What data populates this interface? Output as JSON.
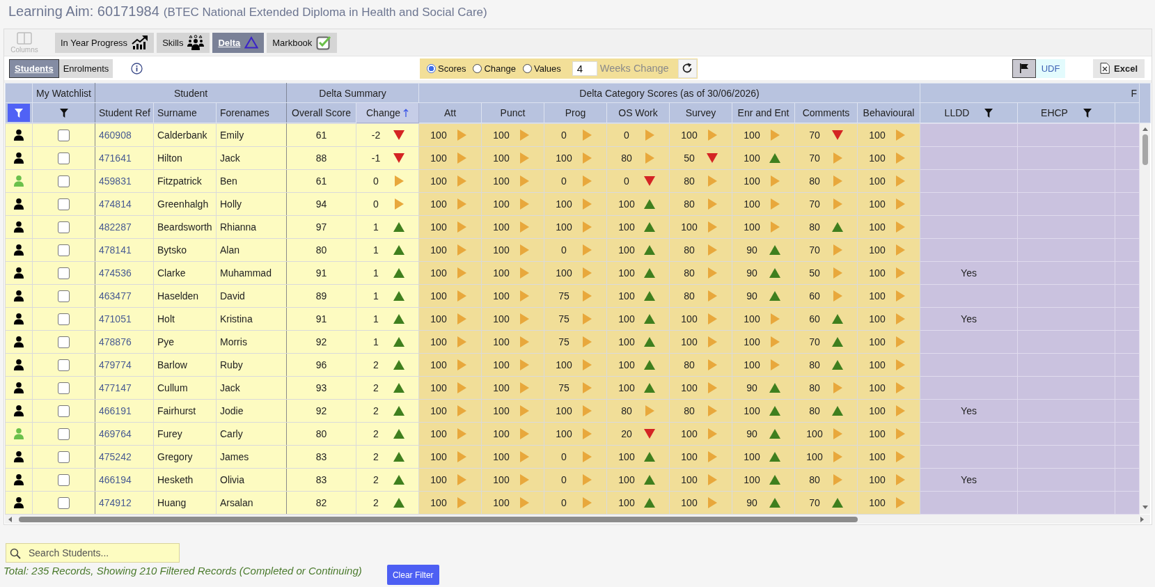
{
  "title": {
    "aim": "Learning Aim: 60171984",
    "qualification": "(BTEC National Extended Diploma in Health and Social Care)"
  },
  "toolbar": {
    "columns_button": {
      "label": "Columns",
      "disabled": true
    },
    "views": [
      {
        "label": "In Year Progress",
        "selected": false
      },
      {
        "label": "Skills",
        "selected": false
      },
      {
        "label": "Delta",
        "selected": true
      },
      {
        "label": "Markbook",
        "selected": false
      }
    ]
  },
  "grid_bar": {
    "modes": [
      {
        "label": "Students",
        "selected": true
      },
      {
        "label": "Enrolments",
        "selected": false
      }
    ],
    "display_options": [
      {
        "label": "Scores",
        "selected": true
      },
      {
        "label": "Change",
        "selected": false
      },
      {
        "label": "Values",
        "selected": false
      }
    ],
    "weeks_change": {
      "value": "4",
      "label": "Weeks Change"
    },
    "flag_toggle": {
      "on": true
    },
    "udf_button": {
      "label": "UDF"
    },
    "excel_button": {
      "label": "Excel"
    }
  },
  "table": {
    "groups": [
      {
        "label": "My Watchlist",
        "columns": [
          {
            "kind": "filter"
          }
        ]
      },
      {
        "label": "Student",
        "columns": [
          {
            "kind": "plain",
            "label": "Student Ref"
          },
          {
            "kind": "plain",
            "label": "Surname"
          },
          {
            "kind": "plain",
            "label": "Forenames"
          }
        ]
      },
      {
        "label": "Delta Summary",
        "columns": [
          {
            "kind": "plain",
            "label": "Overall Score"
          },
          {
            "kind": "sorted",
            "label": "Change"
          }
        ]
      },
      {
        "label": "Delta Category Scores (as of 30/06/2026)",
        "columns": [
          {
            "kind": "plain",
            "label": "Att"
          },
          {
            "kind": "plain",
            "label": "Punct"
          },
          {
            "kind": "plain",
            "label": "Prog"
          },
          {
            "kind": "plain",
            "label": "OS Work"
          },
          {
            "kind": "plain",
            "label": "Survey"
          },
          {
            "kind": "plain",
            "label": "Enr and Ent"
          },
          {
            "kind": "plain",
            "label": "Comments"
          },
          {
            "kind": "plain",
            "label": "Behavioural"
          }
        ]
      },
      {
        "label": "F",
        "columns": [
          {
            "kind": "filter",
            "label": "LLDD"
          },
          {
            "kind": "filter",
            "label": "EHCP"
          },
          {
            "kind": "blank"
          }
        ]
      }
    ],
    "rows": [
      {
        "color": "#000000",
        "watchlist": false,
        "ref": "460908",
        "surname": "Calderbank",
        "forenames": "Emily",
        "overall": "61",
        "change": {
          "value": "-2",
          "kind": "down"
        },
        "scores": [
          {
            "value": "100",
            "kind": "flat"
          },
          {
            "value": "100",
            "kind": "flat"
          },
          {
            "value": "0",
            "kind": "flat"
          },
          {
            "value": "0",
            "kind": "flat"
          },
          {
            "value": "100",
            "kind": "flat"
          },
          {
            "value": "100",
            "kind": "flat"
          },
          {
            "value": "70",
            "kind": "down"
          },
          {
            "value": "100",
            "kind": "flat"
          }
        ]
      },
      {
        "color": "#000000",
        "watchlist": false,
        "ref": "471641",
        "surname": "Hilton",
        "forenames": "Jack",
        "overall": "88",
        "change": {
          "value": "-1",
          "kind": "down"
        },
        "scores": [
          {
            "value": "100",
            "kind": "flat"
          },
          {
            "value": "100",
            "kind": "flat"
          },
          {
            "value": "100",
            "kind": "flat"
          },
          {
            "value": "80",
            "kind": "flat"
          },
          {
            "value": "50",
            "kind": "down"
          },
          {
            "value": "100",
            "kind": "up"
          },
          {
            "value": "70",
            "kind": "flat"
          },
          {
            "value": "100",
            "kind": "flat"
          }
        ]
      },
      {
        "color": "#6bc04b",
        "watchlist": false,
        "ref": "459831",
        "surname": "Fitzpatrick",
        "forenames": "Ben",
        "overall": "61",
        "change": {
          "value": "0",
          "kind": "flat"
        },
        "scores": [
          {
            "value": "100",
            "kind": "flat"
          },
          {
            "value": "100",
            "kind": "flat"
          },
          {
            "value": "0",
            "kind": "flat"
          },
          {
            "value": "0",
            "kind": "down"
          },
          {
            "value": "80",
            "kind": "flat"
          },
          {
            "value": "100",
            "kind": "flat"
          },
          {
            "value": "80",
            "kind": "flat"
          },
          {
            "value": "100",
            "kind": "flat"
          }
        ]
      },
      {
        "color": "#000000",
        "watchlist": false,
        "ref": "474814",
        "surname": "Greenhalgh",
        "forenames": "Holly",
        "overall": "94",
        "change": {
          "value": "0",
          "kind": "flat"
        },
        "scores": [
          {
            "value": "100",
            "kind": "flat"
          },
          {
            "value": "100",
            "kind": "flat"
          },
          {
            "value": "100",
            "kind": "flat"
          },
          {
            "value": "100",
            "kind": "up"
          },
          {
            "value": "80",
            "kind": "flat"
          },
          {
            "value": "100",
            "kind": "flat"
          },
          {
            "value": "70",
            "kind": "flat"
          },
          {
            "value": "100",
            "kind": "flat"
          }
        ]
      },
      {
        "color": "#000000",
        "watchlist": false,
        "ref": "482287",
        "surname": "Beardsworth",
        "forenames": "Rhianna",
        "overall": "97",
        "change": {
          "value": "1",
          "kind": "up"
        },
        "scores": [
          {
            "value": "100",
            "kind": "flat"
          },
          {
            "value": "100",
            "kind": "flat"
          },
          {
            "value": "100",
            "kind": "flat"
          },
          {
            "value": "100",
            "kind": "up"
          },
          {
            "value": "100",
            "kind": "flat"
          },
          {
            "value": "100",
            "kind": "flat"
          },
          {
            "value": "80",
            "kind": "up"
          },
          {
            "value": "100",
            "kind": "flat"
          }
        ]
      },
      {
        "color": "#000000",
        "watchlist": false,
        "ref": "478141",
        "surname": "Bytsko",
        "forenames": "Alan",
        "overall": "80",
        "change": {
          "value": "1",
          "kind": "up"
        },
        "scores": [
          {
            "value": "100",
            "kind": "flat"
          },
          {
            "value": "100",
            "kind": "flat"
          },
          {
            "value": "0",
            "kind": "flat"
          },
          {
            "value": "100",
            "kind": "up"
          },
          {
            "value": "80",
            "kind": "flat"
          },
          {
            "value": "90",
            "kind": "up"
          },
          {
            "value": "70",
            "kind": "flat"
          },
          {
            "value": "100",
            "kind": "flat"
          }
        ]
      },
      {
        "color": "#000000",
        "watchlist": false,
        "ref": "474536",
        "surname": "Clarke",
        "forenames": "Muhammad",
        "overall": "91",
        "change": {
          "value": "1",
          "kind": "up"
        },
        "scores": [
          {
            "value": "100",
            "kind": "flat"
          },
          {
            "value": "100",
            "kind": "flat"
          },
          {
            "value": "100",
            "kind": "flat"
          },
          {
            "value": "100",
            "kind": "up"
          },
          {
            "value": "80",
            "kind": "flat"
          },
          {
            "value": "90",
            "kind": "up"
          },
          {
            "value": "50",
            "kind": "flat"
          },
          {
            "value": "100",
            "kind": "flat"
          }
        ],
        "lldd": "Yes"
      },
      {
        "color": "#000000",
        "watchlist": false,
        "ref": "463477",
        "surname": "Haselden",
        "forenames": "David",
        "overall": "89",
        "change": {
          "value": "1",
          "kind": "up"
        },
        "scores": [
          {
            "value": "100",
            "kind": "flat"
          },
          {
            "value": "100",
            "kind": "flat"
          },
          {
            "value": "75",
            "kind": "flat"
          },
          {
            "value": "100",
            "kind": "up"
          },
          {
            "value": "80",
            "kind": "flat"
          },
          {
            "value": "90",
            "kind": "up"
          },
          {
            "value": "60",
            "kind": "flat"
          },
          {
            "value": "100",
            "kind": "flat"
          }
        ]
      },
      {
        "color": "#000000",
        "watchlist": false,
        "ref": "471051",
        "surname": "Holt",
        "forenames": "Kristina",
        "overall": "91",
        "change": {
          "value": "1",
          "kind": "up"
        },
        "scores": [
          {
            "value": "100",
            "kind": "flat"
          },
          {
            "value": "100",
            "kind": "flat"
          },
          {
            "value": "75",
            "kind": "flat"
          },
          {
            "value": "100",
            "kind": "up"
          },
          {
            "value": "100",
            "kind": "flat"
          },
          {
            "value": "100",
            "kind": "flat"
          },
          {
            "value": "60",
            "kind": "up"
          },
          {
            "value": "100",
            "kind": "flat"
          }
        ],
        "lldd": "Yes"
      },
      {
        "color": "#000000",
        "watchlist": false,
        "ref": "478876",
        "surname": "Pye",
        "forenames": "Morris",
        "overall": "92",
        "change": {
          "value": "1",
          "kind": "up"
        },
        "scores": [
          {
            "value": "100",
            "kind": "flat"
          },
          {
            "value": "100",
            "kind": "flat"
          },
          {
            "value": "75",
            "kind": "flat"
          },
          {
            "value": "100",
            "kind": "up"
          },
          {
            "value": "100",
            "kind": "flat"
          },
          {
            "value": "100",
            "kind": "flat"
          },
          {
            "value": "70",
            "kind": "up"
          },
          {
            "value": "100",
            "kind": "flat"
          }
        ]
      },
      {
        "color": "#000000",
        "watchlist": false,
        "ref": "479774",
        "surname": "Barlow",
        "forenames": "Ruby",
        "overall": "96",
        "change": {
          "value": "2",
          "kind": "up"
        },
        "scores": [
          {
            "value": "100",
            "kind": "flat"
          },
          {
            "value": "100",
            "kind": "flat"
          },
          {
            "value": "100",
            "kind": "flat"
          },
          {
            "value": "100",
            "kind": "up"
          },
          {
            "value": "80",
            "kind": "flat"
          },
          {
            "value": "100",
            "kind": "flat"
          },
          {
            "value": "80",
            "kind": "up"
          },
          {
            "value": "100",
            "kind": "flat"
          }
        ]
      },
      {
        "color": "#000000",
        "watchlist": false,
        "ref": "477147",
        "surname": "Cullum",
        "forenames": "Jack",
        "overall": "93",
        "change": {
          "value": "2",
          "kind": "up"
        },
        "scores": [
          {
            "value": "100",
            "kind": "flat"
          },
          {
            "value": "100",
            "kind": "flat"
          },
          {
            "value": "75",
            "kind": "flat"
          },
          {
            "value": "100",
            "kind": "up"
          },
          {
            "value": "100",
            "kind": "flat"
          },
          {
            "value": "90",
            "kind": "up"
          },
          {
            "value": "80",
            "kind": "flat"
          },
          {
            "value": "100",
            "kind": "flat"
          }
        ]
      },
      {
        "color": "#000000",
        "watchlist": false,
        "ref": "466191",
        "surname": "Fairhurst",
        "forenames": "Jodie",
        "overall": "92",
        "change": {
          "value": "2",
          "kind": "up"
        },
        "scores": [
          {
            "value": "100",
            "kind": "flat"
          },
          {
            "value": "100",
            "kind": "flat"
          },
          {
            "value": "100",
            "kind": "flat"
          },
          {
            "value": "80",
            "kind": "flat"
          },
          {
            "value": "80",
            "kind": "flat"
          },
          {
            "value": "100",
            "kind": "up"
          },
          {
            "value": "80",
            "kind": "up"
          },
          {
            "value": "100",
            "kind": "flat"
          }
        ],
        "lldd": "Yes"
      },
      {
        "color": "#6bc04b",
        "watchlist": false,
        "ref": "469764",
        "surname": "Furey",
        "forenames": "Carly",
        "overall": "80",
        "change": {
          "value": "2",
          "kind": "up"
        },
        "scores": [
          {
            "value": "100",
            "kind": "flat"
          },
          {
            "value": "100",
            "kind": "flat"
          },
          {
            "value": "100",
            "kind": "flat"
          },
          {
            "value": "20",
            "kind": "down"
          },
          {
            "value": "100",
            "kind": "flat"
          },
          {
            "value": "90",
            "kind": "up"
          },
          {
            "value": "100",
            "kind": "flat"
          },
          {
            "value": "100",
            "kind": "flat"
          }
        ]
      },
      {
        "color": "#000000",
        "watchlist": false,
        "ref": "475242",
        "surname": "Gregory",
        "forenames": "James",
        "overall": "83",
        "change": {
          "value": "2",
          "kind": "up"
        },
        "scores": [
          {
            "value": "100",
            "kind": "flat"
          },
          {
            "value": "100",
            "kind": "flat"
          },
          {
            "value": "0",
            "kind": "flat"
          },
          {
            "value": "100",
            "kind": "up"
          },
          {
            "value": "100",
            "kind": "flat"
          },
          {
            "value": "100",
            "kind": "up"
          },
          {
            "value": "100",
            "kind": "flat"
          },
          {
            "value": "100",
            "kind": "flat"
          }
        ]
      },
      {
        "color": "#000000",
        "watchlist": false,
        "ref": "466194",
        "surname": "Hesketh",
        "forenames": "Olivia",
        "overall": "83",
        "change": {
          "value": "2",
          "kind": "up"
        },
        "scores": [
          {
            "value": "100",
            "kind": "flat"
          },
          {
            "value": "100",
            "kind": "flat"
          },
          {
            "value": "0",
            "kind": "flat"
          },
          {
            "value": "100",
            "kind": "up"
          },
          {
            "value": "100",
            "kind": "flat"
          },
          {
            "value": "100",
            "kind": "up"
          },
          {
            "value": "80",
            "kind": "flat"
          },
          {
            "value": "100",
            "kind": "flat"
          }
        ],
        "lldd": "Yes"
      },
      {
        "color": "#000000",
        "watchlist": false,
        "ref": "474912",
        "surname": "Huang",
        "forenames": "Arsalan",
        "overall": "82",
        "change": {
          "value": "2",
          "kind": "up"
        },
        "scores": [
          {
            "value": "100",
            "kind": "flat"
          },
          {
            "value": "100",
            "kind": "flat"
          },
          {
            "value": "0",
            "kind": "flat"
          },
          {
            "value": "100",
            "kind": "up"
          },
          {
            "value": "100",
            "kind": "flat"
          },
          {
            "value": "90",
            "kind": "up"
          },
          {
            "value": "70",
            "kind": "up"
          },
          {
            "value": "100",
            "kind": "flat"
          }
        ]
      }
    ]
  },
  "footer": {
    "search": {
      "placeholder": "Search Students..."
    },
    "summary": "Total: 235 Records, Showing 210 Filtered Records (Completed or Continuing)",
    "clear_filter": {
      "label": "Clear Filter"
    }
  }
}
